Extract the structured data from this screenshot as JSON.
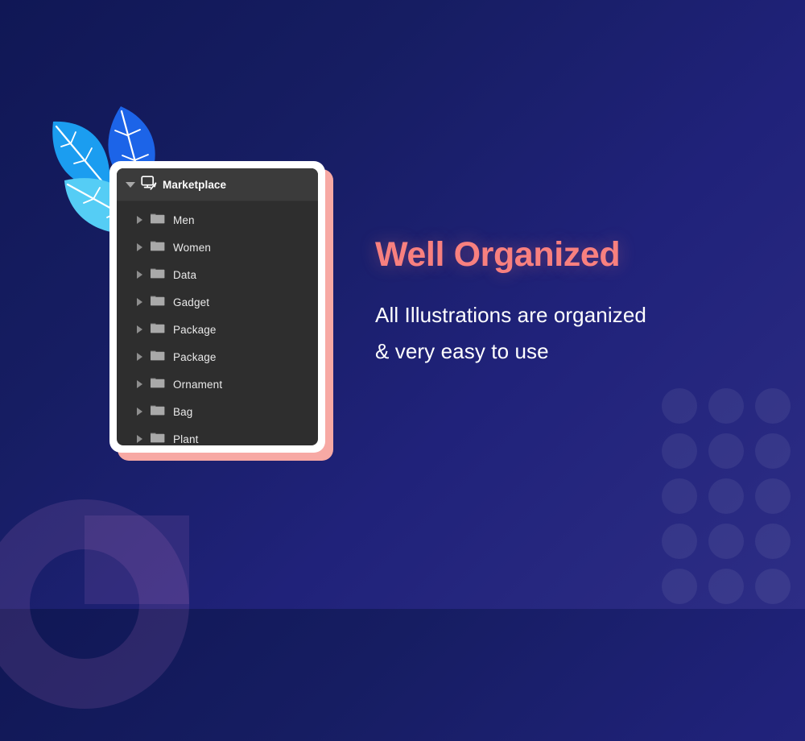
{
  "background": {
    "gradient_from": "#101755",
    "gradient_to": "#2d2d85",
    "decor": {
      "ring_color": "#ba78c3",
      "dot_color": "#ffffff",
      "dot_rows": 5,
      "dot_cols": 3
    }
  },
  "leaves": {
    "name": "leaf-cluster-illustration",
    "colors": {
      "left_leaf": "#1b9df0",
      "center_leaf": "#1c64e8",
      "front_leaf": "#55cdf5",
      "vein": "#ffffff"
    }
  },
  "panel": {
    "frame_color": "#ffffff",
    "shadow_color": "#f7a9a4",
    "body_color": "#2e2e2e",
    "header_color": "#3b3b3b",
    "header": {
      "disclosure": "▼",
      "icon": "artboard-pencil-icon",
      "label": "Marketplace"
    },
    "rows": [
      {
        "disclosure": "▶",
        "icon": "folder-icon",
        "label": "Men"
      },
      {
        "disclosure": "▶",
        "icon": "folder-icon",
        "label": "Women"
      },
      {
        "disclosure": "▶",
        "icon": "folder-icon",
        "label": "Data"
      },
      {
        "disclosure": "▶",
        "icon": "folder-icon",
        "label": "Gadget"
      },
      {
        "disclosure": "▶",
        "icon": "folder-icon",
        "label": "Package"
      },
      {
        "disclosure": "▶",
        "icon": "folder-icon",
        "label": "Package"
      },
      {
        "disclosure": "▶",
        "icon": "folder-icon",
        "label": "Ornament"
      },
      {
        "disclosure": "▶",
        "icon": "folder-icon",
        "label": "Bag"
      },
      {
        "disclosure": "▶",
        "icon": "folder-icon",
        "label": "Plant"
      }
    ]
  },
  "copy": {
    "headline": "Well Organized",
    "headline_color": "#f8807f",
    "subcopy_line1": "All Illustrations are organized",
    "subcopy_line2": "& very easy to use",
    "subcopy_color": "#ffffff"
  }
}
